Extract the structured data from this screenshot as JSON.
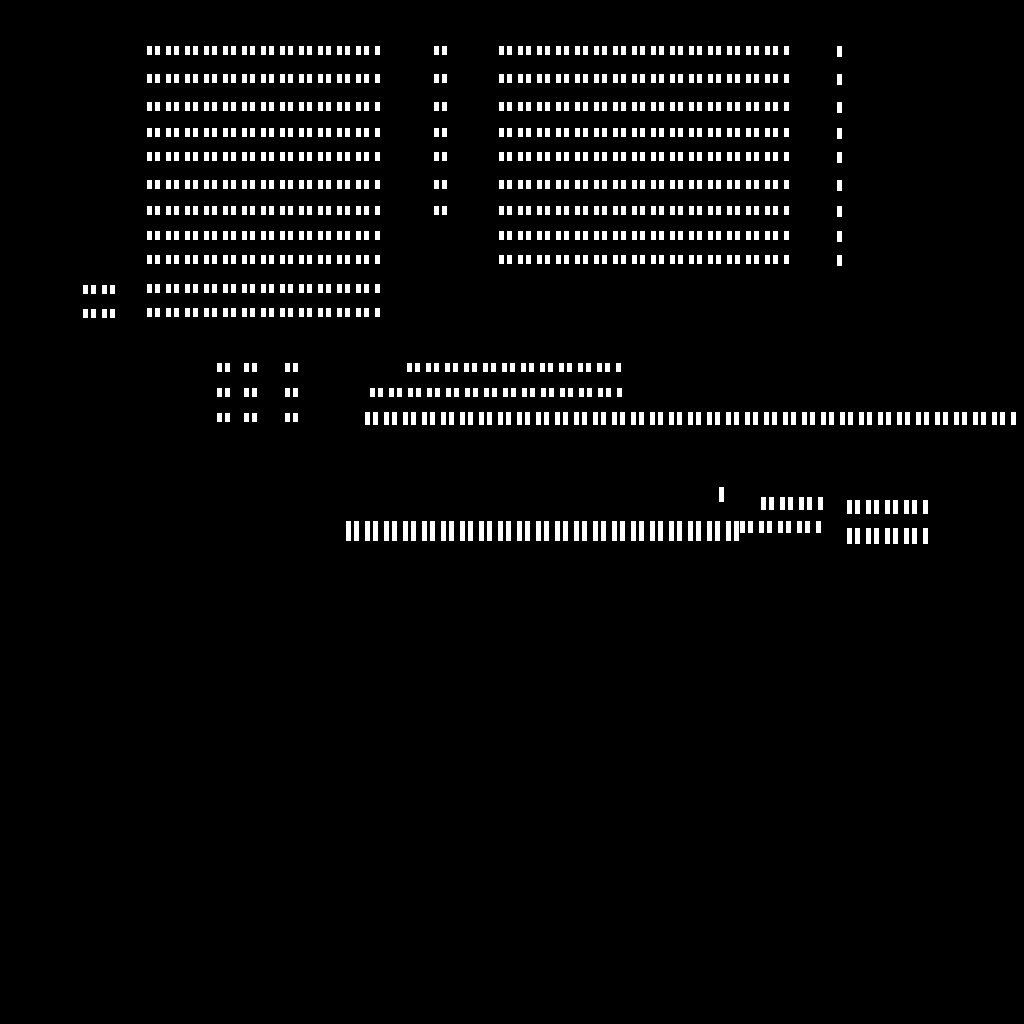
{
  "screen": {
    "background_color": "#000000",
    "glyph_color": "#ffffff",
    "note_text": "",
    "left_label_top": "",
    "left_label_bottom": "",
    "top_columns": {
      "col_a_rows": [
        "",
        "",
        "",
        "",
        "",
        "",
        "",
        "",
        "",
        "",
        ""
      ],
      "col_b_rows": [
        "",
        "",
        "",
        "",
        "",
        "",
        ""
      ],
      "col_c_rows": [
        "",
        "",
        "",
        "",
        "",
        "",
        "",
        "",
        ""
      ],
      "col_d_rows": [
        "",
        "",
        "",
        "",
        "",
        "",
        "",
        "",
        ""
      ]
    },
    "middle_block": {
      "left_cells": [
        "",
        "",
        "",
        "",
        "",
        "",
        "",
        "",
        ""
      ],
      "right_rows": [
        "",
        "",
        ""
      ]
    },
    "bottom_block": {
      "row_1": "",
      "row_2": ""
    }
  }
}
